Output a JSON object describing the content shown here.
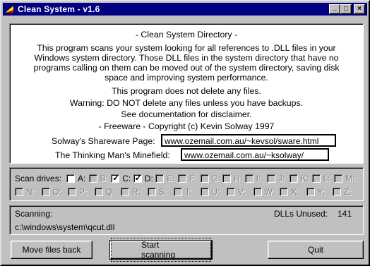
{
  "window": {
    "title": "Clean System - v1.6",
    "controls": {
      "minimize": "_",
      "maximize": "□",
      "close": "×"
    }
  },
  "info": {
    "heading": "- Clean System Directory -",
    "description": [
      "This program scans your system looking for all references to .DLL files in your",
      "Windows system directory.  Those DLL files in the system directory that have no",
      "programs calling on them can be moved out of the system directory, saving disk",
      "space and improving system performance."
    ],
    "no_delete": "This program does not delete any files.",
    "warning": [
      "Warning: DO NOT delete any files unless you have backups.",
      "See documentation for disclaimer."
    ],
    "copyright": "- Freeware -   Copyright (c) Kevin Solway 1997",
    "links": [
      {
        "label": "Solway's Shareware Page:",
        "url": "www.ozemail.com.au/~kevsol/sware.html"
      },
      {
        "label": "The Thinking Man's Minefield:",
        "url": "www.ozemail.com.au/~ksolway/"
      }
    ]
  },
  "scan_drives": {
    "label": "Scan drives:",
    "drives": [
      {
        "letter": "A:",
        "checked": false,
        "enabled": true
      },
      {
        "letter": "B:",
        "checked": false,
        "enabled": false
      },
      {
        "letter": "C:",
        "checked": true,
        "enabled": true
      },
      {
        "letter": "D:",
        "checked": true,
        "enabled": true
      },
      {
        "letter": "E:",
        "checked": false,
        "enabled": false
      },
      {
        "letter": "F:",
        "checked": false,
        "enabled": false
      },
      {
        "letter": "G:",
        "checked": false,
        "enabled": false
      },
      {
        "letter": "H:",
        "checked": false,
        "enabled": false
      },
      {
        "letter": "I:",
        "checked": false,
        "enabled": false
      },
      {
        "letter": "J:",
        "checked": false,
        "enabled": false
      },
      {
        "letter": "K:",
        "checked": false,
        "enabled": false
      },
      {
        "letter": "L:",
        "checked": false,
        "enabled": false
      },
      {
        "letter": "M:",
        "checked": false,
        "enabled": false
      },
      {
        "letter": "N:",
        "checked": false,
        "enabled": false
      },
      {
        "letter": "O:",
        "checked": false,
        "enabled": false
      },
      {
        "letter": "P:",
        "checked": false,
        "enabled": false
      },
      {
        "letter": "Q:",
        "checked": false,
        "enabled": false
      },
      {
        "letter": "R:",
        "checked": false,
        "enabled": false
      },
      {
        "letter": "S:",
        "checked": false,
        "enabled": false
      },
      {
        "letter": "T:",
        "checked": false,
        "enabled": false
      },
      {
        "letter": "U:",
        "checked": false,
        "enabled": false
      },
      {
        "letter": "V:",
        "checked": false,
        "enabled": false
      },
      {
        "letter": "W:",
        "checked": false,
        "enabled": false
      },
      {
        "letter": "X:",
        "checked": false,
        "enabled": false
      },
      {
        "letter": "Y:",
        "checked": false,
        "enabled": false
      },
      {
        "letter": "Z:",
        "checked": false,
        "enabled": false
      }
    ]
  },
  "status": {
    "scanning_label": "Scanning:",
    "current_file": "c:\\windows\\system\\qcut.dll",
    "dlls_unused_label": "DLLs Unused:",
    "dlls_unused_count": "141"
  },
  "buttons": {
    "move_back": "Move files back",
    "start": "Start scanning",
    "quit": "Quit"
  }
}
